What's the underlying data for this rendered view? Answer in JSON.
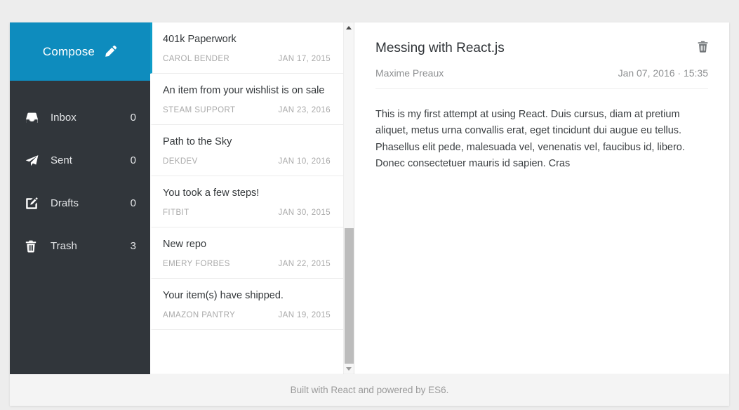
{
  "theme": {
    "accent": "#0e9dc9",
    "compose_bg": "#0e8cbe",
    "sidebar_bg": "#31363b",
    "page_bg": "#ededed"
  },
  "sidebar": {
    "compose": {
      "label": "Compose",
      "icon": "pencil-icon"
    },
    "items": [
      {
        "label": "Inbox",
        "count": "0",
        "icon": "inbox-icon"
      },
      {
        "label": "Sent",
        "count": "0",
        "icon": "paper-plane-icon"
      },
      {
        "label": "Drafts",
        "count": "0",
        "icon": "edit-square-icon"
      },
      {
        "label": "Trash",
        "count": "3",
        "icon": "trash-icon"
      }
    ]
  },
  "email_list": {
    "items": [
      {
        "subject": "401k Paperwork",
        "sender": "CAROL BENDER",
        "date": "JAN 17, 2015",
        "selected": true
      },
      {
        "subject": "An item from your wishlist is on sale",
        "sender": "STEAM SUPPORT",
        "date": "JAN 23, 2016",
        "selected": false
      },
      {
        "subject": "Path to the Sky",
        "sender": "DEKDEV",
        "date": "JAN 10, 2016",
        "selected": false
      },
      {
        "subject": "You took a few steps!",
        "sender": "FITBIT",
        "date": "JAN 30, 2015",
        "selected": false
      },
      {
        "subject": "New repo",
        "sender": "EMERY FORBES",
        "date": "JAN 22, 2015",
        "selected": false
      },
      {
        "subject": "Your item(s) have shipped.",
        "sender": "AMAZON PANTRY",
        "date": "JAN 19, 2015",
        "selected": false
      }
    ]
  },
  "reading_pane": {
    "subject": "Messing with React.js",
    "sender": "Maxime Preaux",
    "timestamp": "Jan 07, 2016 · 15:35",
    "delete_icon": "trash-icon",
    "body": "This is my first attempt at using React. Duis cursus, diam at pretium aliquet, metus urna convallis erat, eget tincidunt dui augue eu tellus. Phasellus elit pede, malesuada vel, venenatis vel, faucibus id, libero. Donec consectetuer mauris id sapien. Cras"
  },
  "footer": {
    "text": "Built with React and powered by ES6."
  }
}
